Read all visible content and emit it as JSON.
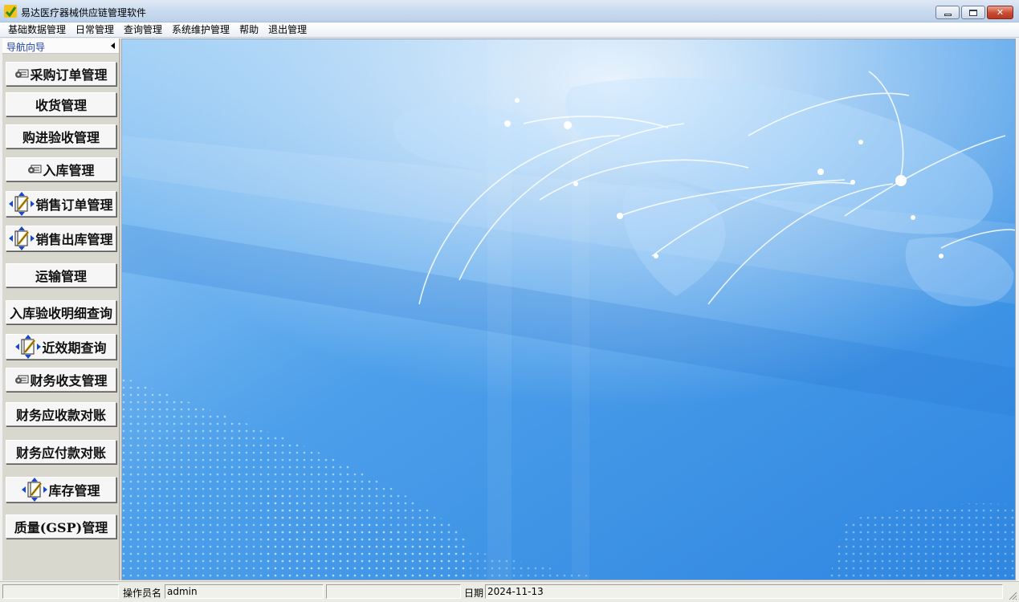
{
  "window": {
    "title": "易达医疗器械供应链管理软件"
  },
  "menu": [
    "基础数据管理",
    "日常管理",
    "查询管理",
    "系统维护管理",
    "帮助",
    "退出管理"
  ],
  "nav": {
    "title": "导航向导",
    "items": [
      {
        "label": "采购订单管理",
        "icon": "tool-icon"
      },
      {
        "label": "收货管理",
        "icon": ""
      },
      {
        "label": "购进验收管理",
        "icon": ""
      },
      {
        "label": "入库管理",
        "icon": "tool-icon"
      },
      {
        "label": "销售订单管理",
        "icon": "notebook-pencil-icon"
      },
      {
        "label": "销售出库管理",
        "icon": "notebook-pencil-icon"
      },
      {
        "label": "运输管理",
        "icon": ""
      },
      {
        "label": "入库验收明细查询",
        "icon": ""
      },
      {
        "label": "近效期查询",
        "icon": "notebook-pencil-icon"
      },
      {
        "label": "财务收支管理",
        "icon": "tool-icon"
      },
      {
        "label": "财务应收款对账",
        "icon": ""
      },
      {
        "label": "财务应付款对账",
        "icon": ""
      },
      {
        "label": "库存管理",
        "icon": "notebook-pencil-icon"
      },
      {
        "label": "质量(GSP)管理",
        "icon": ""
      }
    ]
  },
  "status": {
    "operator_label": "操作员名",
    "operator_value": "admin",
    "date_label": "日期",
    "date_value": "2024-11-13"
  },
  "colors": {
    "nav_title": "#1c3fa8",
    "background_blue": "#3f8ee2"
  }
}
